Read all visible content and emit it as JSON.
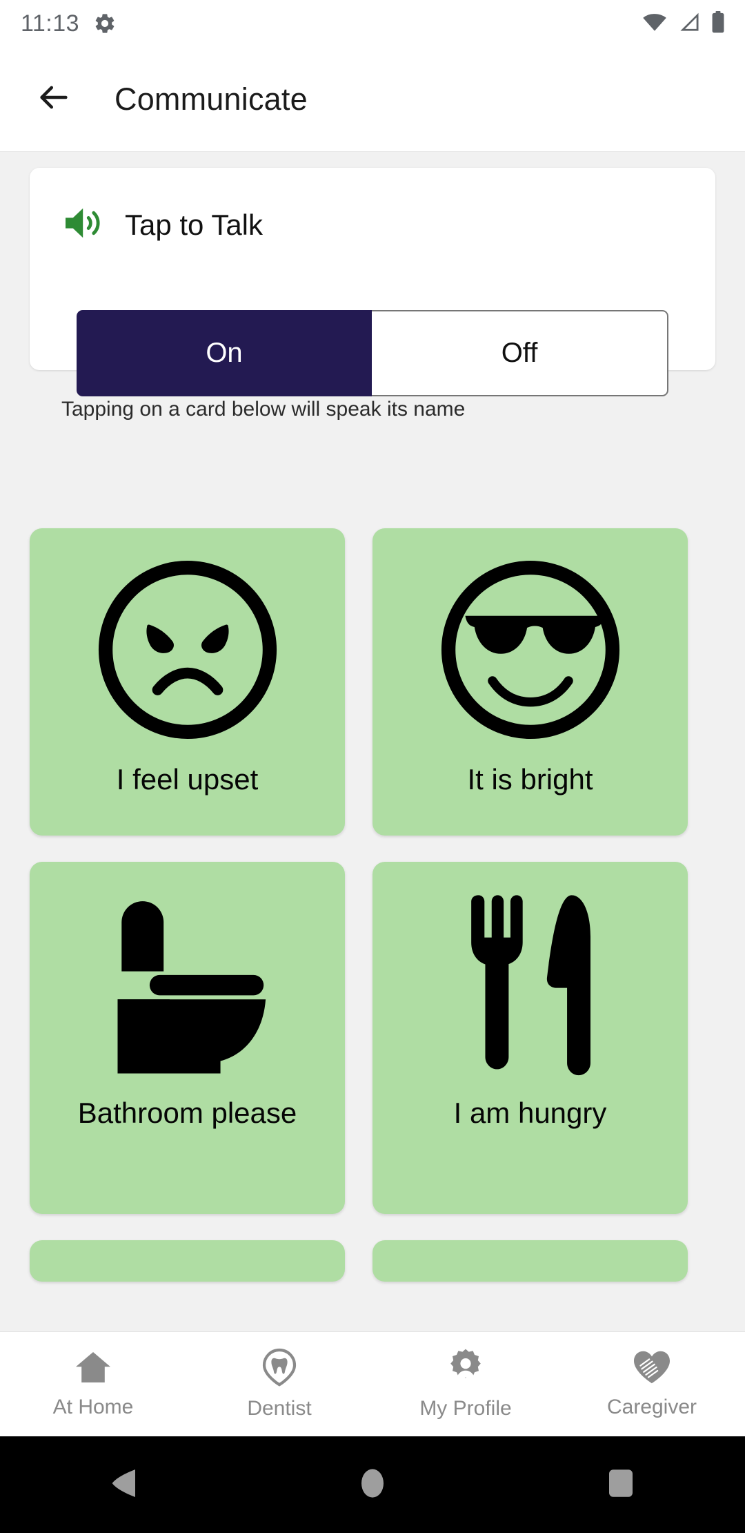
{
  "status_bar": {
    "time": "11:13",
    "icons": [
      "gear-icon",
      "wifi-icon",
      "cellular-signal-icon",
      "battery-icon"
    ]
  },
  "app_bar": {
    "back_icon": "arrow-left-icon",
    "title": "Communicate"
  },
  "talk_card": {
    "speaker_icon": "volume-up-icon",
    "title": "Tap to Talk",
    "accent_green": "#2e8b34",
    "selected": "On",
    "options": [
      {
        "label": "On",
        "selected": true
      },
      {
        "label": "Off",
        "selected": false
      }
    ],
    "hint": "Tapping on a card below will speak its name",
    "selected_bg": "#231a52",
    "selected_fg": "#ffffff"
  },
  "cards": {
    "card_bg": "#afdda3",
    "items": [
      {
        "label": "I feel upset",
        "icon": "angry-face-icon"
      },
      {
        "label": "It is bright",
        "icon": "sunglasses-face-icon"
      },
      {
        "label": "Bathroom please",
        "icon": "toilet-icon"
      },
      {
        "label": "I am hungry",
        "icon": "fork-knife-icon"
      }
    ]
  },
  "bottom_nav": {
    "items": [
      {
        "label": "At Home",
        "icon": "home-icon"
      },
      {
        "label": "Dentist",
        "icon": "tooth-pin-icon"
      },
      {
        "label": "My Profile",
        "icon": "profile-badge-icon"
      },
      {
        "label": "Caregiver",
        "icon": "heart-hands-icon"
      }
    ],
    "label_color": "#8a8a8a"
  },
  "system_bar": {
    "buttons": [
      {
        "name": "back-triangle-icon"
      },
      {
        "name": "home-circle-icon"
      },
      {
        "name": "recents-square-icon"
      }
    ]
  }
}
